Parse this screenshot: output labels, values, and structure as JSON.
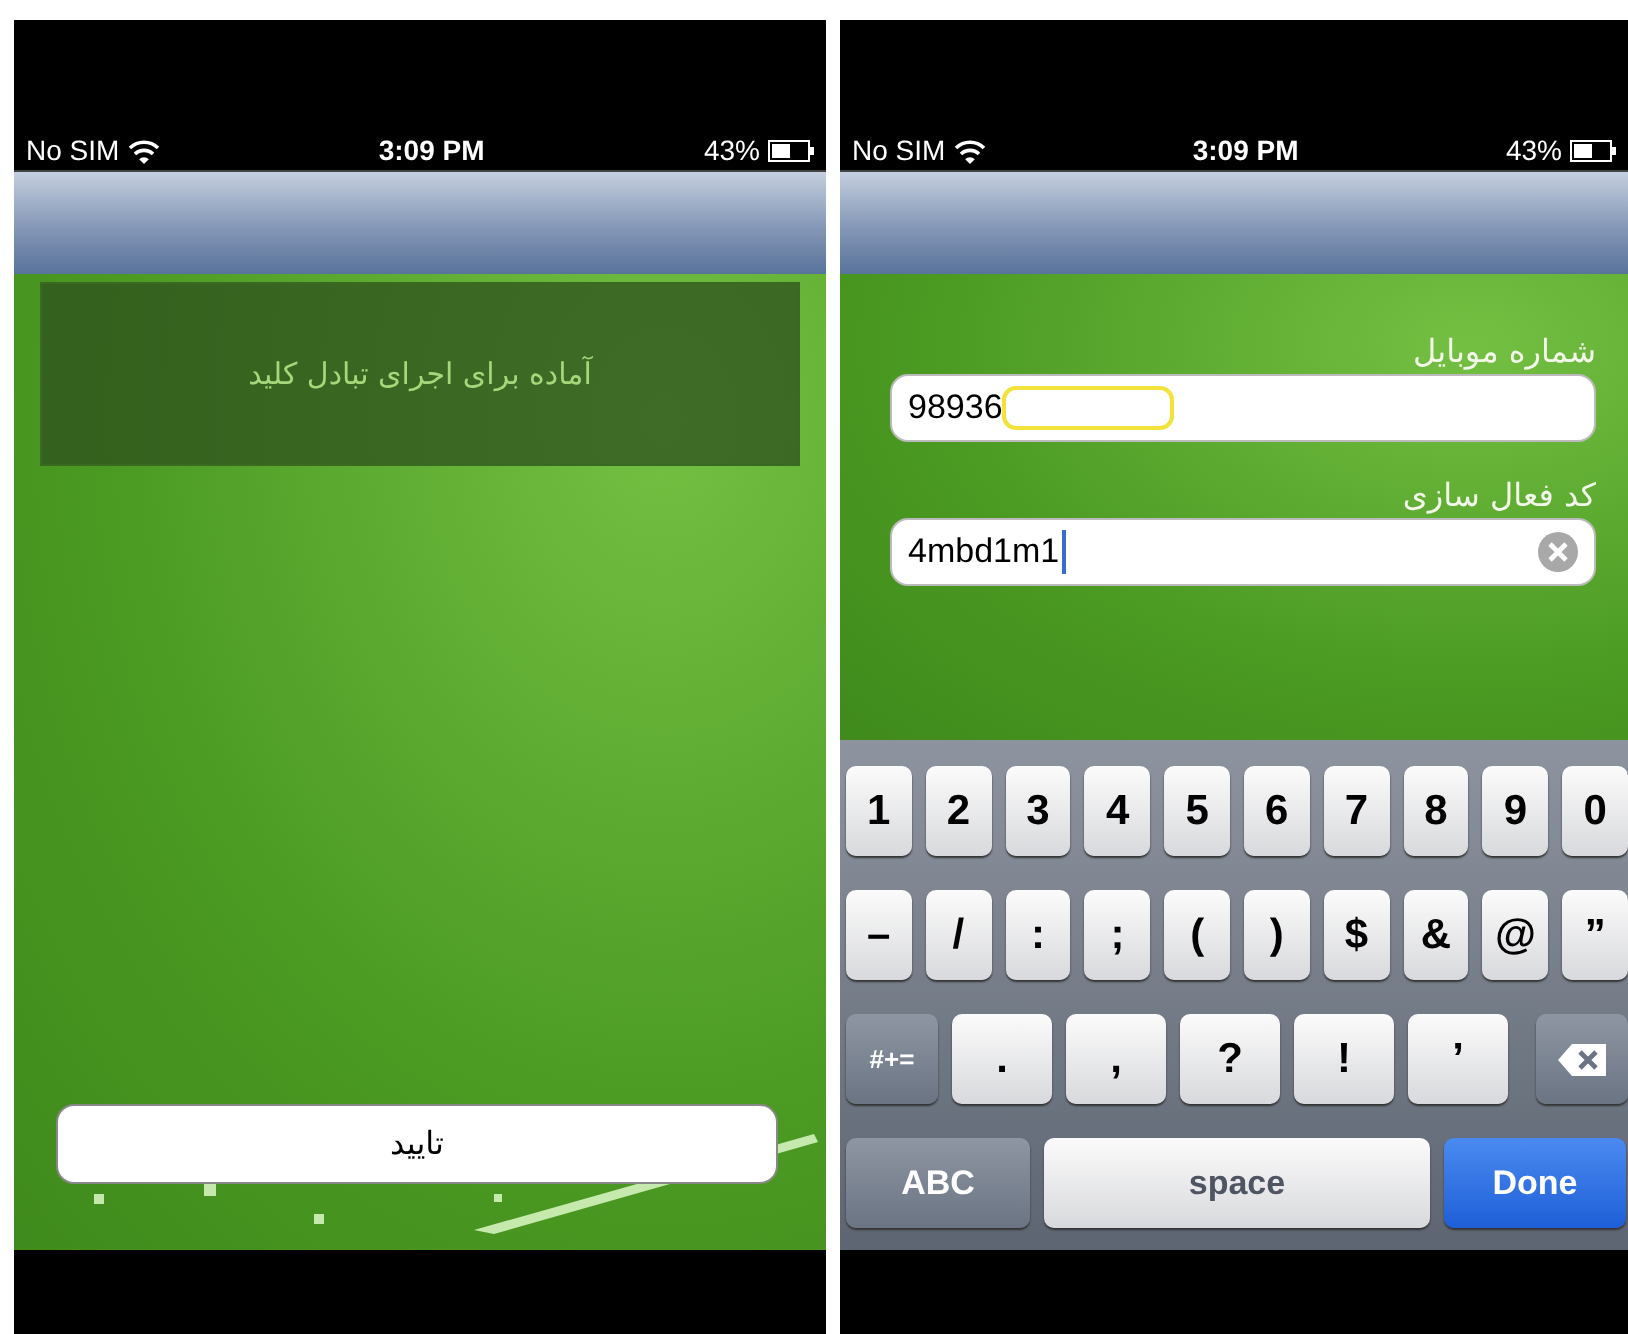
{
  "screens": [
    {
      "status_bar": {
        "carrier": "No SIM",
        "time": "3:09 PM",
        "battery": "43%"
      },
      "message": "آماده برای اجرای تبادل کلید",
      "confirm_button": "تایید"
    },
    {
      "status_bar": {
        "carrier": "No SIM",
        "time": "3:09 PM",
        "battery": "43%"
      },
      "form": [
        {
          "label": "شماره موبایل",
          "value": "98936",
          "redacted": true,
          "focused": false,
          "clear_button": false
        },
        {
          "label": "کد فعال سازی",
          "value": "4mbd1m1",
          "redacted": false,
          "focused": true,
          "clear_button": true
        }
      ],
      "keyboard": [
        [
          {
            "kind": "char",
            "label": "1"
          },
          {
            "kind": "char",
            "label": "2"
          },
          {
            "kind": "char",
            "label": "3"
          },
          {
            "kind": "char",
            "label": "4"
          },
          {
            "kind": "char",
            "label": "5"
          },
          {
            "kind": "char",
            "label": "6"
          },
          {
            "kind": "char",
            "label": "7"
          },
          {
            "kind": "char",
            "label": "8"
          },
          {
            "kind": "char",
            "label": "9"
          },
          {
            "kind": "char",
            "label": "0"
          }
        ],
        [
          {
            "kind": "char",
            "label": "–"
          },
          {
            "kind": "char",
            "label": "/"
          },
          {
            "kind": "char",
            "label": ":"
          },
          {
            "kind": "char",
            "label": ";"
          },
          {
            "kind": "char",
            "label": "("
          },
          {
            "kind": "char",
            "label": ")"
          },
          {
            "kind": "char",
            "label": "$"
          },
          {
            "kind": "char",
            "label": "&"
          },
          {
            "kind": "char",
            "label": "@"
          },
          {
            "kind": "char",
            "label": "”"
          }
        ],
        [
          {
            "kind": "function",
            "label": "#+="
          },
          {
            "kind": "wide",
            "label": "."
          },
          {
            "kind": "wide",
            "label": ","
          },
          {
            "kind": "wide",
            "label": "?"
          },
          {
            "kind": "wide",
            "label": "!"
          },
          {
            "kind": "wide",
            "label": "’"
          },
          {
            "kind": "delete"
          }
        ],
        [
          {
            "kind": "mode",
            "label": "ABC"
          },
          {
            "kind": "space",
            "label": "space"
          },
          {
            "kind": "done",
            "label": "Done"
          }
        ]
      ]
    }
  ]
}
